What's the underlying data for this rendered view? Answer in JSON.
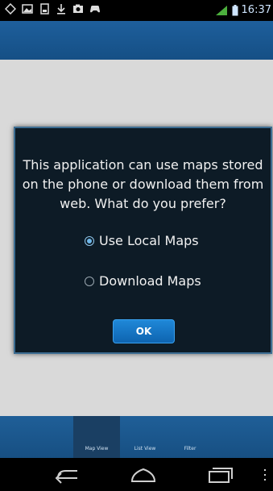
{
  "status_bar": {
    "time": "16:37",
    "network_label": "H",
    "left_icons": [
      "diamond-icon",
      "image-icon",
      "sd-card-icon",
      "download-icon",
      "camera-icon",
      "game-controller-icon"
    ]
  },
  "dialog": {
    "message": "This application can use maps stored on the phone or download them from web. What do you prefer?",
    "options": [
      {
        "label": "Use Local Maps",
        "selected": true
      },
      {
        "label": "Download Maps",
        "selected": false
      }
    ],
    "ok_label": "OK"
  },
  "tabs": [
    {
      "label": "Map View",
      "active": true
    },
    {
      "label": "List View",
      "active": false
    },
    {
      "label": "Filter",
      "active": false
    }
  ],
  "colors": {
    "app_bar": "#1a5a95",
    "dialog_bg": "#0d1b26",
    "accent": "#1478c8"
  }
}
